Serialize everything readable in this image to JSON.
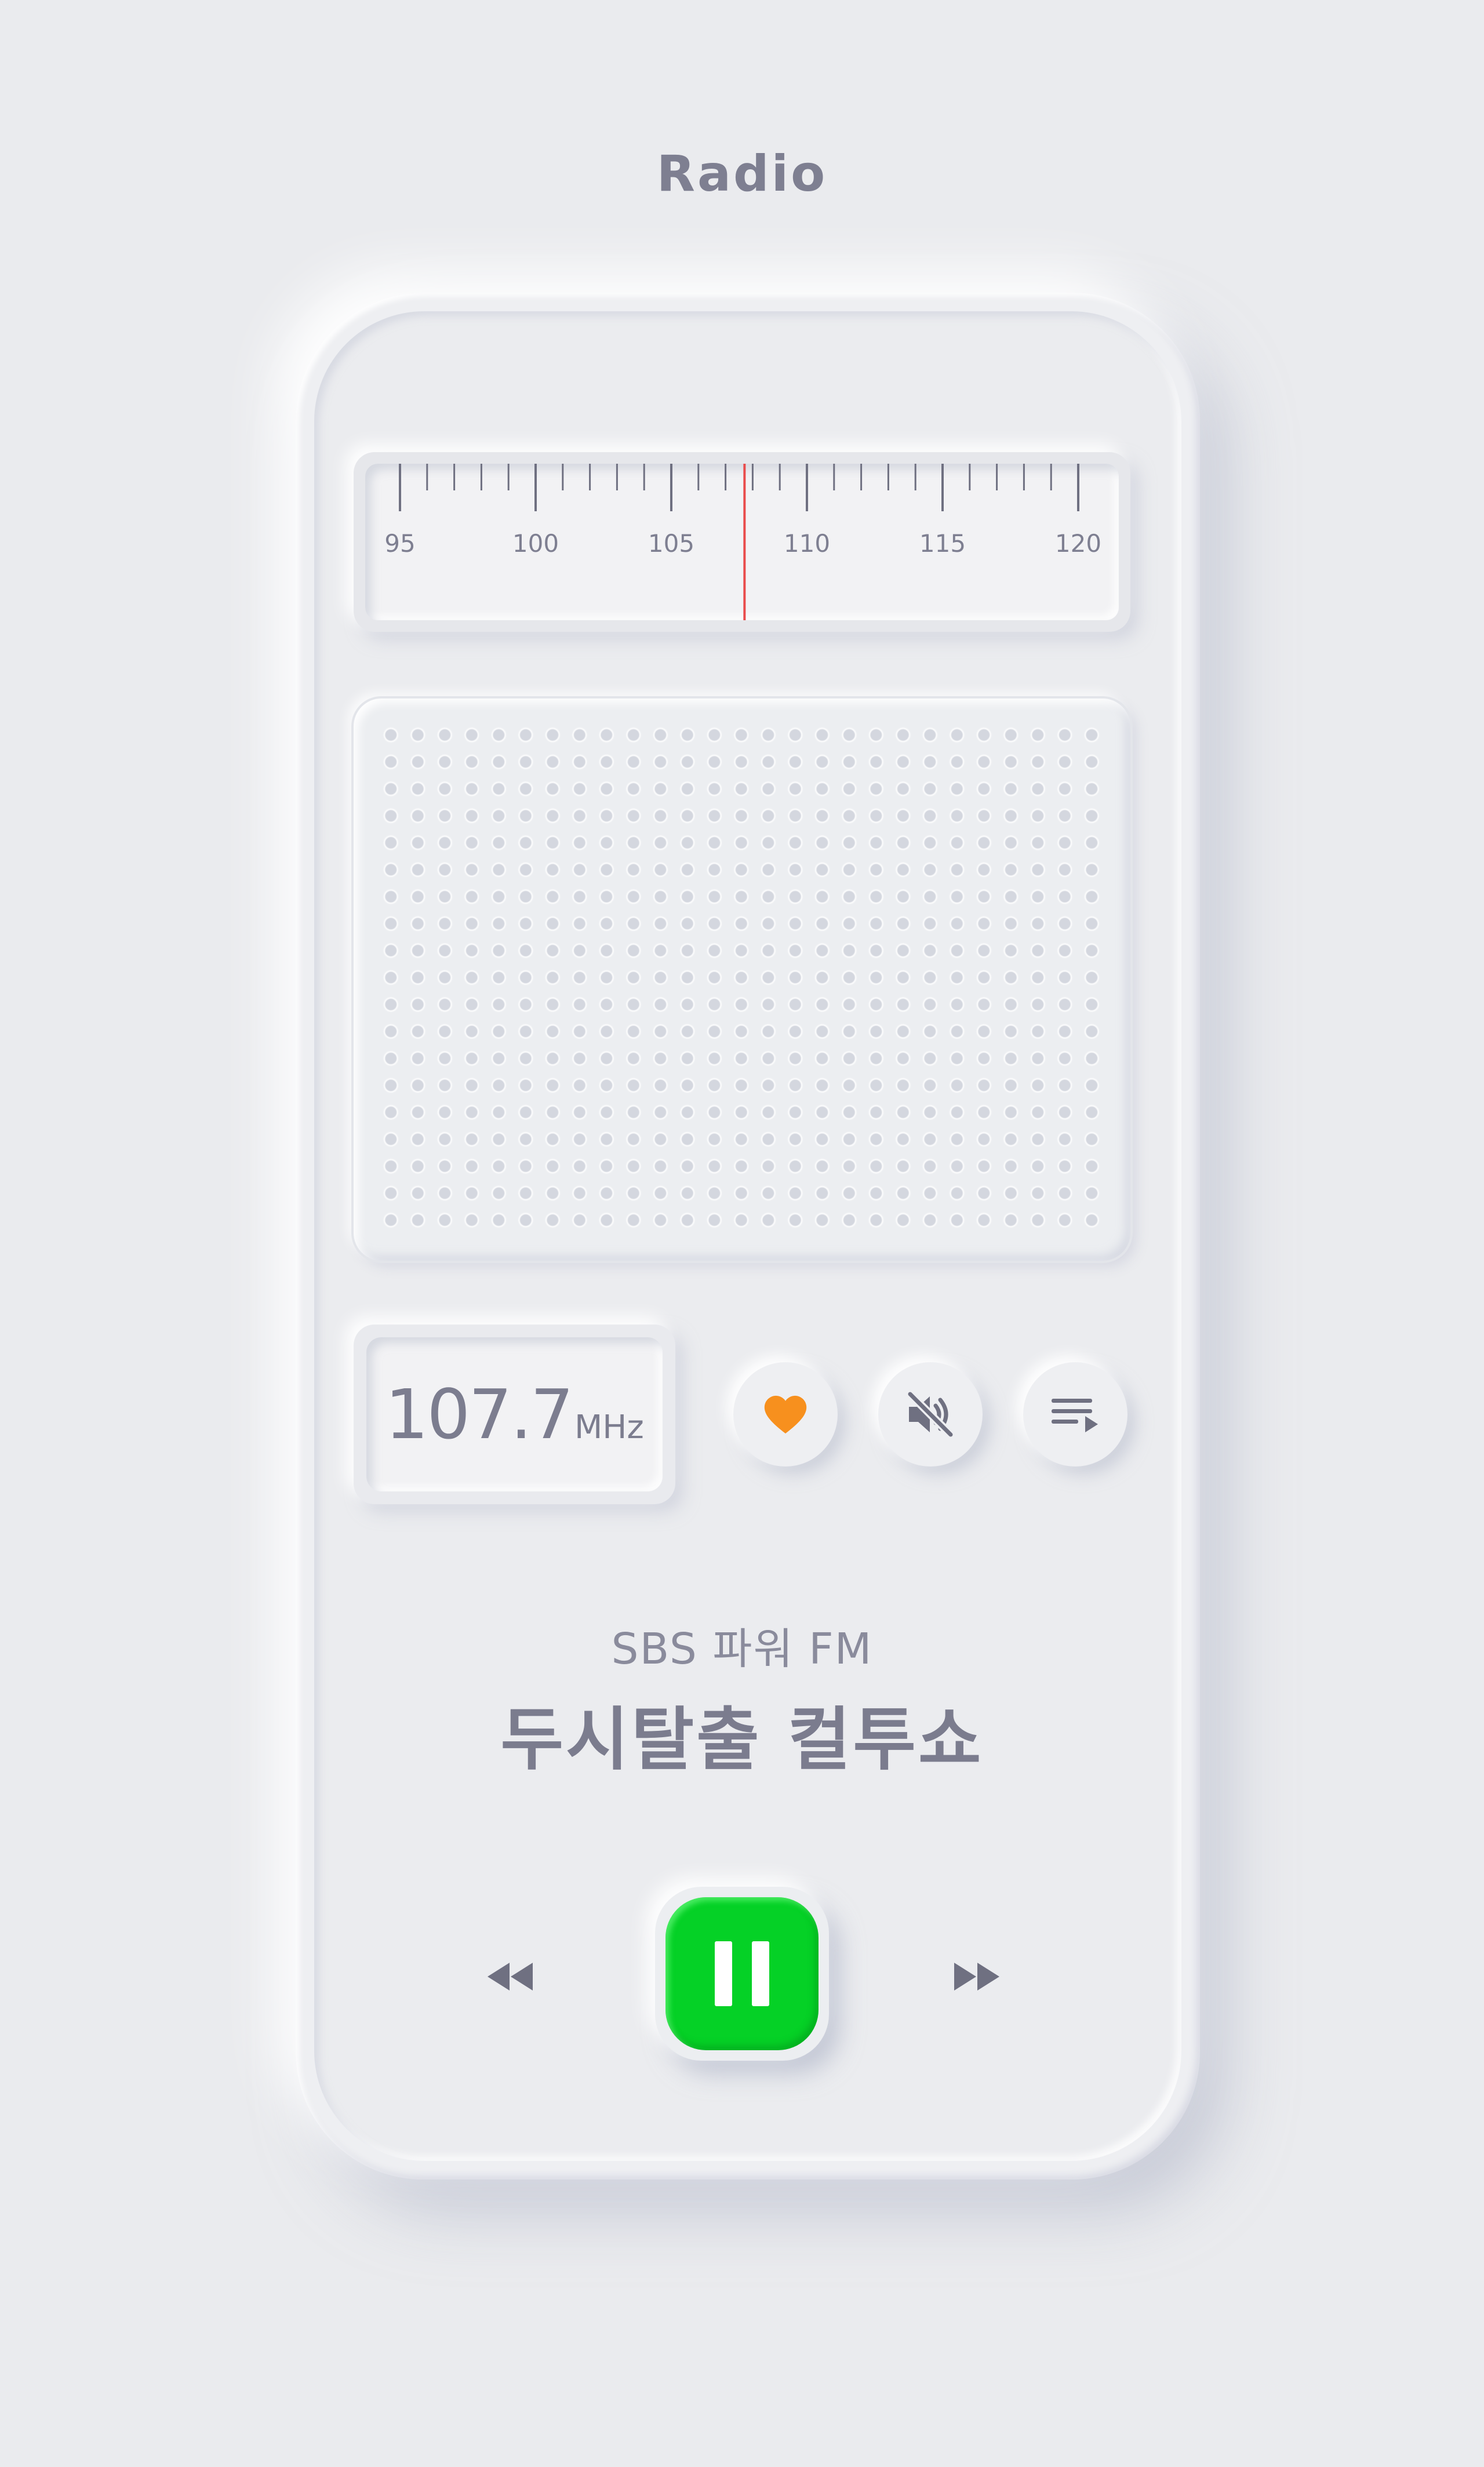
{
  "header": {
    "title": "Radio"
  },
  "tuner": {
    "scale_labels": [
      "95",
      "100",
      "105",
      "110",
      "115",
      "120"
    ],
    "scale_min": 95,
    "scale_max": 120,
    "needle_frequency": 107.7,
    "needle_color": "#e94b4b"
  },
  "frequency": {
    "value": "107.7",
    "unit": "MHz"
  },
  "controls": {
    "favorite_icon": "heart-icon",
    "favorite_color": "#f7901e",
    "mute_icon": "speaker-muted-icon",
    "playlist_icon": "playlist-icon"
  },
  "now_playing": {
    "station": "SBS 파워 FM",
    "program": "두시탈출 컬투쇼"
  },
  "transport": {
    "rewind_icon": "rewind-icon",
    "pause_icon": "pause-icon",
    "forward_icon": "fast-forward-icon",
    "play_color": "#05d126"
  },
  "colors": {
    "background": "#eaebee",
    "text": "#7e7f91"
  }
}
